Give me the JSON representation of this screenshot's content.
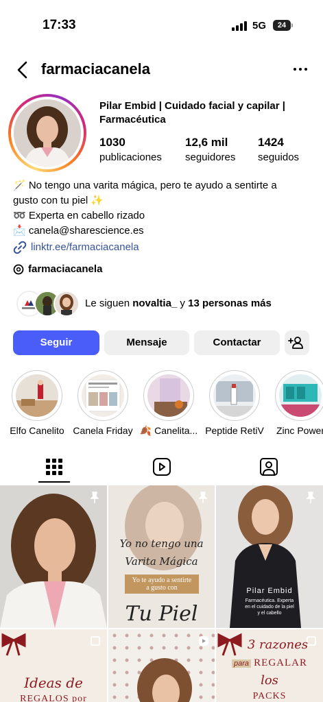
{
  "status_bar": {
    "time": "17:33",
    "network": "5G",
    "battery": "24"
  },
  "header": {
    "username": "farmaciacanela"
  },
  "profile": {
    "display_name": "Pilar Embid | Cuidado facial y capilar | Farmacéutica",
    "stats": [
      {
        "value": "1030",
        "label": "publicaciones"
      },
      {
        "value": "12,6 mil",
        "label": "seguidores"
      },
      {
        "value": "1424",
        "label": "seguidos"
      }
    ],
    "bio_lines": [
      "🪄 No tengo una varita mágica, pero te ayudo a sentirte a",
      "gusto con tu piel ✨",
      "➿ Experta en cabello rizado",
      "📩 canela@sharescience.es"
    ],
    "link": "linktr.ee/farmaciacanela",
    "threads_handle": "farmaciacanela",
    "followed_by": {
      "prefix": "Le siguen ",
      "account": "novaltia_",
      "middle": " y ",
      "others": "13 personas más"
    }
  },
  "buttons": {
    "follow": "Seguir",
    "message": "Mensaje",
    "contact": "Contactar"
  },
  "highlights": [
    {
      "label": "Elfo Canelito"
    },
    {
      "label": "Canela Friday"
    },
    {
      "label": "🍂 Canelita..."
    },
    {
      "label": "Peptide RetiV"
    },
    {
      "label": "Zinc Power"
    }
  ],
  "grid": {
    "post_2": {
      "line1": "Yo no tengo una",
      "line2": "Varita Mágica",
      "line3": "Yo te ayudo a sentirte",
      "line4": "a gusto con",
      "line5": "Tu Piel"
    },
    "post_3": {
      "name": "Pilar Embid",
      "caption_1": "Farmacéutica. Experta",
      "caption_2": "en el cuidado de la piel",
      "caption_3": "y el cabello"
    },
    "post_4": {
      "line1": "Ideas de",
      "line2": "REGALOS por"
    },
    "post_6": {
      "line1": "3 razones",
      "line2": "para",
      "line3": "REGALAR",
      "line4": "los",
      "line5": "PACKS"
    }
  },
  "colors": {
    "follow_button": "#4a5df9",
    "link": "#37539c",
    "secondary_button": "#efefef"
  }
}
